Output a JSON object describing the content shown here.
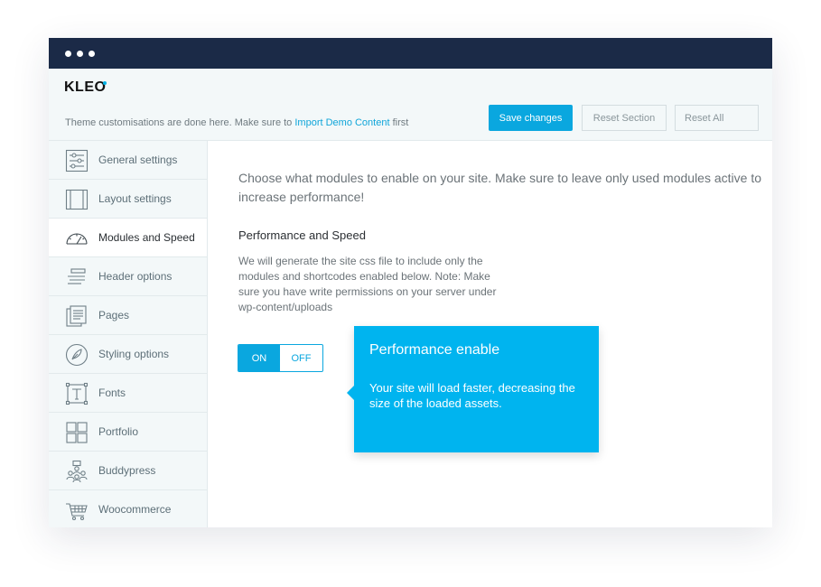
{
  "window": {
    "logo": "KLEO",
    "subtitle_before": "Theme customisations are done here. Make sure to ",
    "subtitle_link": "Import Demo Content",
    "subtitle_after": " first"
  },
  "toolbar": {
    "save_label": "Save changes",
    "reset_section_label": "Reset Section",
    "reset_all_label": "Reset All"
  },
  "sidebar": {
    "items": [
      {
        "label": "General settings",
        "icon": "sliders-icon"
      },
      {
        "label": "Layout settings",
        "icon": "layout-icon"
      },
      {
        "label": "Modules and Speed",
        "icon": "speedometer-icon",
        "active": true
      },
      {
        "label": "Header options",
        "icon": "header-lines-icon"
      },
      {
        "label": "Pages",
        "icon": "pages-icon"
      },
      {
        "label": "Styling options",
        "icon": "feather-icon"
      },
      {
        "label": "Fonts",
        "icon": "font-icon"
      },
      {
        "label": "Portfolio",
        "icon": "grid-icon"
      },
      {
        "label": "Buddypress",
        "icon": "people-icon"
      },
      {
        "label": "Woocommerce",
        "icon": "cart-icon"
      }
    ]
  },
  "main": {
    "intro": "Choose what modules to enable on your site. Make sure to leave only used modules active to increase performance!",
    "section_title": "Performance and Speed",
    "description": "We will generate the site css file to include only the modules and shortcodes enabled below. Note: Make sure you have write permissions on your server under wp-content/uploads",
    "toggle": {
      "on_label": "ON",
      "off_label": "OFF",
      "state": "on"
    }
  },
  "tooltip": {
    "title": "Performance enable",
    "text": "Your site will load faster, decreasing the size of the loaded assets."
  },
  "colors": {
    "accent": "#0aa7df",
    "titlebar": "#1b2a47",
    "tooltip": "#00b4ef"
  }
}
